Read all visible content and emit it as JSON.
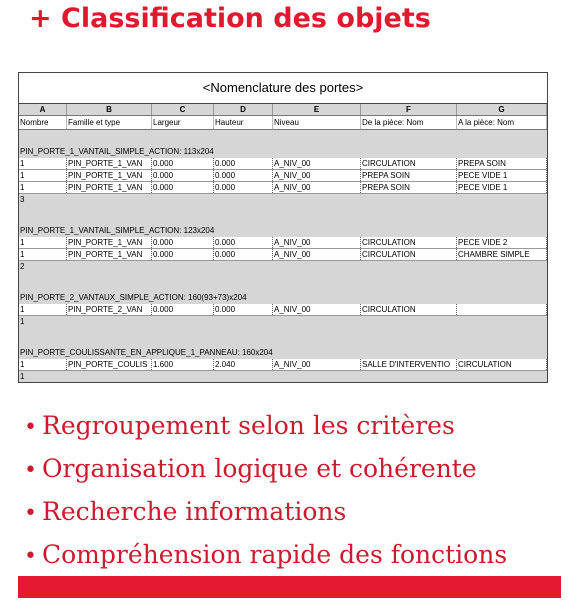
{
  "heading": "+ Classification des objets",
  "schedule": {
    "title": "<Nomenclature des portes>",
    "letters": [
      "A",
      "B",
      "C",
      "D",
      "E",
      "F",
      "G"
    ],
    "headers": [
      "Nombre",
      "Famille et type",
      "Largeur",
      "Hauteur",
      "Niveau",
      "De la pièce: Nom",
      "A la pièce: Nom"
    ],
    "groups": [
      {
        "label": "PIN_PORTE_1_VANTAIL_SIMPLE_ACTION: 113x204",
        "rows": [
          [
            "1",
            "PIN_PORTE_1_VAN",
            "0.000",
            "0.000",
            "A_NIV_00",
            "CIRCULATION",
            "PREPA SOIN"
          ],
          [
            "1",
            "PIN_PORTE_1_VAN",
            "0.000",
            "0.000",
            "A_NIV_00",
            "PREPA SOIN",
            "PECE VIDE 1"
          ],
          [
            "1",
            "PIN_PORTE_1_VAN",
            "0.000",
            "0.000",
            "A_NIV_00",
            "PREPA SOIN",
            "PECE VIDE 1"
          ]
        ],
        "count": "3"
      },
      {
        "label": "PIN_PORTE_1_VANTAIL_SIMPLE_ACTION: 123x204",
        "rows": [
          [
            "1",
            "PIN_PORTE_1_VAN",
            "0.000",
            "0.000",
            "A_NIV_00",
            "CIRCULATION",
            "PECE VIDE 2"
          ],
          [
            "1",
            "PIN_PORTE_1_VAN",
            "0.000",
            "0.000",
            "A_NIV_00",
            "CIRCULATION",
            "CHAMBRE SIMPLE"
          ]
        ],
        "count": "2"
      },
      {
        "label": "PIN_PORTE_2_VANTAUX_SIMPLE_ACTION: 160(93+73)x204",
        "rows": [
          [
            "1",
            "PIN_PORTE_2_VAN",
            "0.000",
            "0.000",
            "A_NIV_00",
            "CIRCULATION",
            ""
          ]
        ],
        "count": "1"
      },
      {
        "label": "PIN_PORTE_COULISSANTE_EN_APPLIQUE_1_PANNEAU: 160x204",
        "rows": [
          [
            "1",
            "PIN_PORTE_COULIS",
            "1.600",
            "2.040",
            "A_NIV_00",
            "SALLE D'INTERVENTIO",
            "CIRCULATION"
          ]
        ],
        "count": "1"
      }
    ]
  },
  "bullets": [
    "Regroupement selon les critères",
    "Organisation logique et cohérente",
    "Recherche informations",
    "Compréhension rapide des fonctions"
  ],
  "colors": {
    "accent": "#e0192e",
    "bullet_text": "#cc1b2e"
  }
}
